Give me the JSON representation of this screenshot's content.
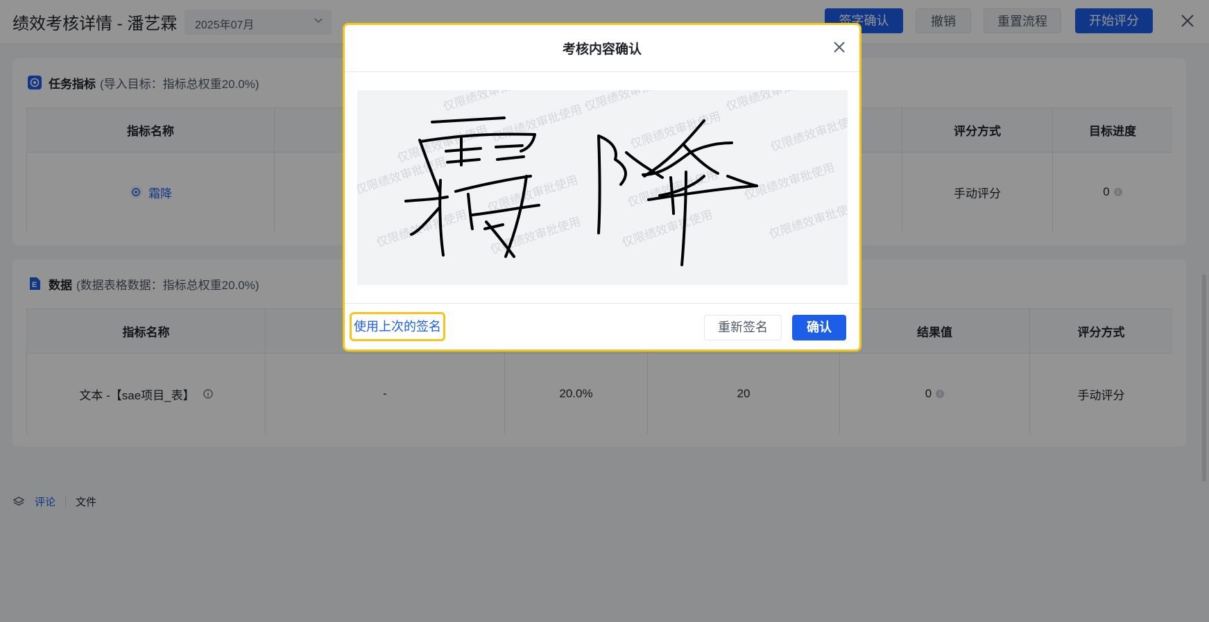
{
  "header": {
    "title": "绩效考核详情 - 潘艺霖",
    "month_value": "2025年07月",
    "buttons": {
      "sign_confirm": "签字确认",
      "revoke": "撤销",
      "reset_flow": "重置流程",
      "start_scoring": "开始评分"
    }
  },
  "task_section": {
    "title": "任务指标",
    "subtitle": "(导入目标：指标总权重20.0%)",
    "columns": [
      "指标名称",
      "评分方式",
      "目标进度"
    ],
    "row": {
      "name": "霜降",
      "scoring": "手动评分",
      "progress": "0"
    }
  },
  "data_section": {
    "title": "数据",
    "subtitle": "(数据表格数据：指标总权重20.0%)",
    "columns": [
      "指标名称",
      "结果值",
      "评分方式"
    ],
    "row": {
      "name": "文本 -【sae项目_表】",
      "c2": "-",
      "c3": "20.0%",
      "c4": "20",
      "result": "0",
      "scoring": "手动评分"
    }
  },
  "comment_tabs": {
    "comments": "评论",
    "files": "文件"
  },
  "modal": {
    "title": "考核内容确认",
    "watermark": "仅限绩效审批使用",
    "use_last_signature": "使用上次的签名",
    "resign": "重新签名",
    "confirm": "确认"
  },
  "colors": {
    "primary": "#1d5ee8",
    "highlight_border": "#f5c518",
    "mask": "rgba(0,0,0,0.42)"
  },
  "icons": [
    "chevron-down-icon",
    "close-icon",
    "target-icon",
    "excel-icon",
    "layers-icon",
    "info-icon"
  ]
}
